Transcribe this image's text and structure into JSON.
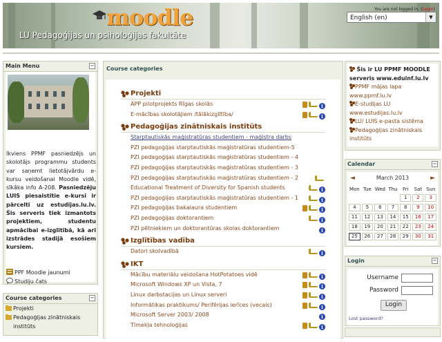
{
  "header": {
    "logo": "moodle",
    "faculty": "LU Pedagoģijas un psiholoģijas fakultāte",
    "login_text": "You are not logged in. (",
    "login_link": "Login",
    "login_close": ")",
    "language": "English (en)"
  },
  "main_menu": {
    "title": "Main Menu",
    "text_part1": "Ikviens PPMF pasniedzējs un skolotājs programmu students var saņemt lietotājvārdu e-kursu veidošanai Moodle vidē, sīkāka info A-208. ",
    "text_bold": "Pasniedzēju LUIS piesaistītie e-kursi ir pārcelti uz estudijas.lu.lv. Šis serveris tiek izmantots projektiem, studentu apmācībai e-izglītībā, kā arī izstrādes stadijā esošiem kursiem.",
    "links": [
      "PPF Moodle jaunumi",
      "Studiju čats"
    ]
  },
  "left_categories": {
    "title": "Course categories",
    "items": [
      "Projekti",
      "Pedagoģijas zinātniskais",
      "institūts"
    ]
  },
  "center": {
    "title": "Course categories",
    "categories": [
      {
        "name": "Projekti",
        "courses": [
          {
            "name": "APP pilotprojekts Rīgas skolās",
            "icons": [
              "person",
              "key",
              "info"
            ],
            "link": false
          },
          {
            "name": "E-mācības skolotājiem /tālākizglītība/",
            "icons": [
              "person",
              "key",
              "info"
            ],
            "link": false
          }
        ]
      },
      {
        "name": "Pedagoģijas zinātniskais institūts",
        "courses": [
          {
            "name": "Starptautiskās maģistratūras studentiem - maģistra darbs",
            "icons": [],
            "link": true
          },
          {
            "name": "PZI pedagoģijas starptautiskās maģistratūras studentiem-5",
            "icons": [],
            "link": false
          },
          {
            "name": "PZI pedagoģijas starptautiskās maģistratūras studentiem - 4",
            "icons": [],
            "link": false
          },
          {
            "name": "PZI pedagoģijas starptautiskās maģistratūras studentiem - 3",
            "icons": [],
            "link": false
          },
          {
            "name": "PZI pedagoģijas starptautiskās maģistratūras studentiem - 2",
            "icons": [
              "key"
            ],
            "link": false
          },
          {
            "name": "Educational Treatment of Diversity for Spanish students",
            "icons": [
              "key",
              "info"
            ],
            "link": false
          },
          {
            "name": "PZI pedagoģijas starptautiskās maģistratūras studentiem - 1",
            "icons": [
              "key",
              "info"
            ],
            "link": false
          },
          {
            "name": "PZI pedagoģijas bakalaura studentiem",
            "icons": [
              "person",
              "key",
              "info"
            ],
            "link": false
          },
          {
            "name": "PZI pedagoģijas doktorantiem",
            "icons": [
              "key",
              "info"
            ],
            "link": false
          },
          {
            "name": "PZI pētniekiem un doktorantūras skolas doktorantiem",
            "icons": [
              "info"
            ],
            "link": false
          }
        ]
      },
      {
        "name": "Izglītības vadība",
        "courses": [
          {
            "name": "Datori skolvadībā",
            "icons": [
              "key",
              "info"
            ],
            "link": false
          }
        ]
      },
      {
        "name": "IKT",
        "courses": [
          {
            "name": "Mācību materiālu veidošana HotPotatoes vidē",
            "icons": [
              "person",
              "key",
              "info"
            ],
            "link": false
          },
          {
            "name": "Microsoft Windows XP un Vista, 7",
            "icons": [
              "person",
              "key",
              "info"
            ],
            "link": false
          },
          {
            "name": "Linux darbstacijas un Linux serveri",
            "icons": [
              "person",
              "key",
              "info"
            ],
            "link": false
          },
          {
            "name": "Informātikas praktikums/ Perifērijas ierīces (vecais)",
            "icons": [
              "person",
              "key",
              "info"
            ],
            "link": false
          },
          {
            "name": "Microsoft Server 2003/ 2008",
            "icons": [
              "info"
            ],
            "link": false
          },
          {
            "name": "Tīmekļa tehnoloģijas",
            "icons": [
              "person",
              "key",
              "info"
            ],
            "link": false
          }
        ]
      }
    ]
  },
  "right_info": {
    "heading": "Šis ir LU PPMF MOODLE serveris www.eduinf.lu.lv",
    "links": [
      "PPMF mājas lapa www.ppmf.lu.lv",
      "E-studijas LU www.estudijas.lu.lv",
      "LU/ LUIS e-pasta sistēma",
      "Pedagoģijas zinātniskais institūts"
    ]
  },
  "calendar": {
    "title": "Calendar",
    "month": "March 2013",
    "prev": "◄",
    "next": "►",
    "weekdays": [
      "Mon",
      "Tue",
      "Wed",
      "Thu",
      "Fri",
      "Sat",
      "Sun"
    ],
    "weeks": [
      [
        "",
        "",
        "",
        "",
        "1",
        "2",
        "3"
      ],
      [
        "4",
        "5",
        "6",
        "7",
        "8",
        "9",
        "10"
      ],
      [
        "11",
        "12",
        "13",
        "14",
        "15",
        "16",
        "17"
      ],
      [
        "18",
        "19",
        "20",
        "21",
        "22",
        "23",
        "24"
      ],
      [
        "25",
        "26",
        "27",
        "28",
        "29",
        "30",
        "31"
      ]
    ],
    "today": "25"
  },
  "login": {
    "title": "Login",
    "username_label": "Username",
    "password_label": "Password",
    "button": "Login",
    "lost": "Lost password?"
  }
}
